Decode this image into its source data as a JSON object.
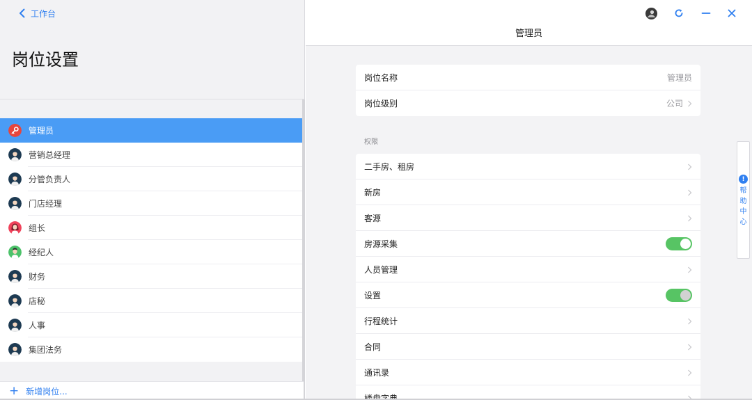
{
  "nav": {
    "back_label": "工作台"
  },
  "left": {
    "title": "岗位设置",
    "roles": [
      {
        "label": "管理员",
        "avatar": "red-key",
        "active": true
      },
      {
        "label": "营销总经理",
        "avatar": "person-male",
        "active": false
      },
      {
        "label": "分管负责人",
        "avatar": "person-male",
        "active": false
      },
      {
        "label": "门店经理",
        "avatar": "person-male",
        "active": false
      },
      {
        "label": "组长",
        "avatar": "person-female",
        "active": false
      },
      {
        "label": "经纪人",
        "avatar": "person-green",
        "active": false
      },
      {
        "label": "财务",
        "avatar": "person-male",
        "active": false
      },
      {
        "label": "店秘",
        "avatar": "person-male",
        "active": false
      },
      {
        "label": "人事",
        "avatar": "person-male",
        "active": false
      },
      {
        "label": "集团法务",
        "avatar": "person-male",
        "active": false
      }
    ],
    "add_label": "新增岗位..."
  },
  "detail": {
    "title": "管理员",
    "basic": [
      {
        "label": "岗位名称",
        "value": "管理员",
        "chevron": false
      },
      {
        "label": "岗位级别",
        "value": "公司",
        "chevron": true
      }
    ],
    "section_label": "权限",
    "permissions": [
      {
        "label": "二手房、租房",
        "type": "chevron"
      },
      {
        "label": "新房",
        "type": "chevron"
      },
      {
        "label": "客源",
        "type": "chevron"
      },
      {
        "label": "房源采集",
        "type": "toggle",
        "on": true
      },
      {
        "label": "人员管理",
        "type": "chevron"
      },
      {
        "label": "设置",
        "type": "toggle",
        "on": true
      },
      {
        "label": "行程统计",
        "type": "chevron"
      },
      {
        "label": "合同",
        "type": "chevron"
      },
      {
        "label": "通讯录",
        "type": "chevron"
      },
      {
        "label": "楼盘字典",
        "type": "chevron"
      }
    ]
  },
  "help": {
    "label": "帮助中心"
  },
  "colors": {
    "accent": "#2f7ff0",
    "active_row": "#4a9cf5",
    "toggle_on": "#57c464",
    "red_avatar": "#e8453c"
  }
}
